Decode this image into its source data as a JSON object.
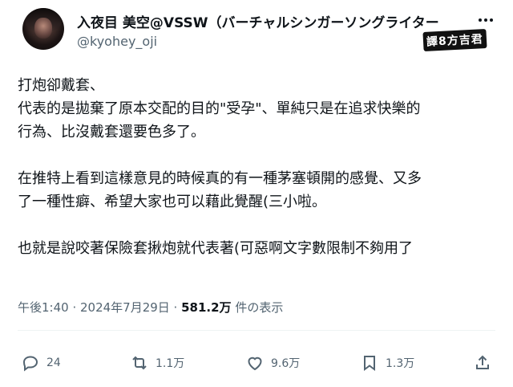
{
  "tweet": {
    "display_name": "入夜目 美空@VSSW（バーチャルシンガーソングライター",
    "username": "@kyohey_oji",
    "watermark": "譯8方吉君",
    "body": "打炮卻戴套、\n代表的是拋棄了原本交配的目的\"受孕\"、單純只是在追求快樂的\n行為、比沒戴套還要色多了。\n\n在推特上看到這樣意見的時候真的有一種茅塞頓開的感覺、又多\n了一種性癖、希望大家也可以藉此覺醒(三小啦。\n\n也就是說咬著保險套揪炮就代表著(可惡啊文字數限制不夠用了",
    "timestamp": "午後1:40 · 2024年7月29日 · ",
    "views_count": "581.2万",
    "views_label": " 件の表示"
  },
  "actions": {
    "reply": {
      "icon": "reply-icon",
      "count": "24"
    },
    "retweet": {
      "icon": "retweet-icon",
      "count": "1.1万"
    },
    "like": {
      "icon": "heart-icon",
      "count": "9.6万"
    },
    "bookmark": {
      "icon": "bookmark-icon",
      "count": "1.3万"
    },
    "share": {
      "icon": "share-icon"
    }
  },
  "colors": {
    "text": "#0f1419",
    "secondary": "#536471",
    "divider": "#eff3f4",
    "background": "#ffffff"
  }
}
